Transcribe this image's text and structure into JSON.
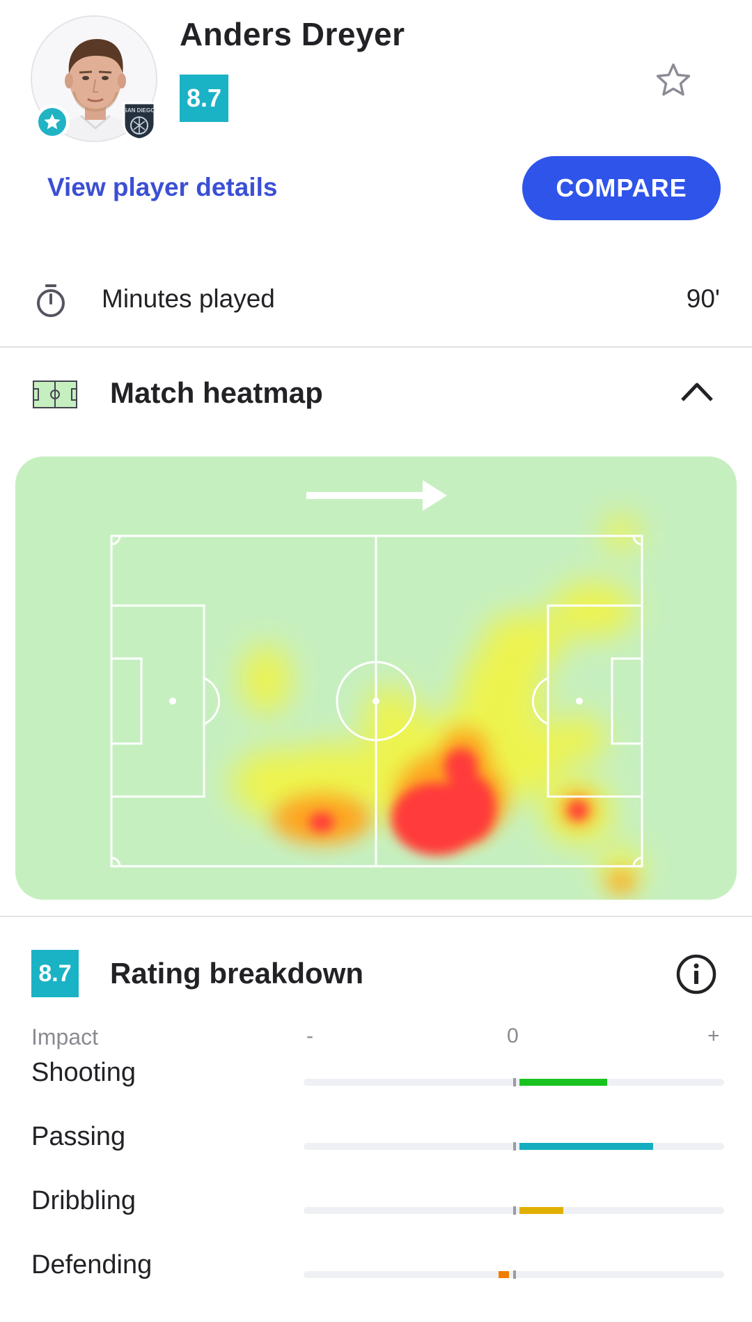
{
  "player": {
    "name": "Anders Dreyer",
    "rating": "8.7",
    "club_badge_text": "SAN DIEGO",
    "favourite_icon": "star-icon"
  },
  "header": {
    "favourite_icon": "star-outline-icon",
    "details_link": "View player details",
    "compare_button": "COMPARE"
  },
  "minutes": {
    "icon": "stopwatch-icon",
    "label": "Minutes played",
    "value": "90'"
  },
  "heatmap": {
    "icon": "pitch-icon",
    "title": "Match heatmap",
    "toggle_icon": "chevron-up-icon",
    "attack_direction": "right",
    "colors": {
      "background": "#c6efc0",
      "low": "#f2f230",
      "mid": "#ff9a1a",
      "high": "#ff3a3a"
    }
  },
  "rating_breakdown": {
    "rating": "8.7",
    "title": "Rating breakdown",
    "info_icon": "info-icon",
    "impact_label": "Impact",
    "scale": {
      "negative": "-",
      "zero": "0",
      "positive": "+"
    },
    "stats": [
      {
        "label": "Shooting",
        "impact": 0.42,
        "color": "#19c31f"
      },
      {
        "label": "Passing",
        "impact": 0.64,
        "color": "#12aebf"
      },
      {
        "label": "Dribbling",
        "impact": 0.21,
        "color": "#e0b000"
      },
      {
        "label": "Defending",
        "impact": -0.05,
        "color": "#f07d00"
      }
    ]
  }
}
